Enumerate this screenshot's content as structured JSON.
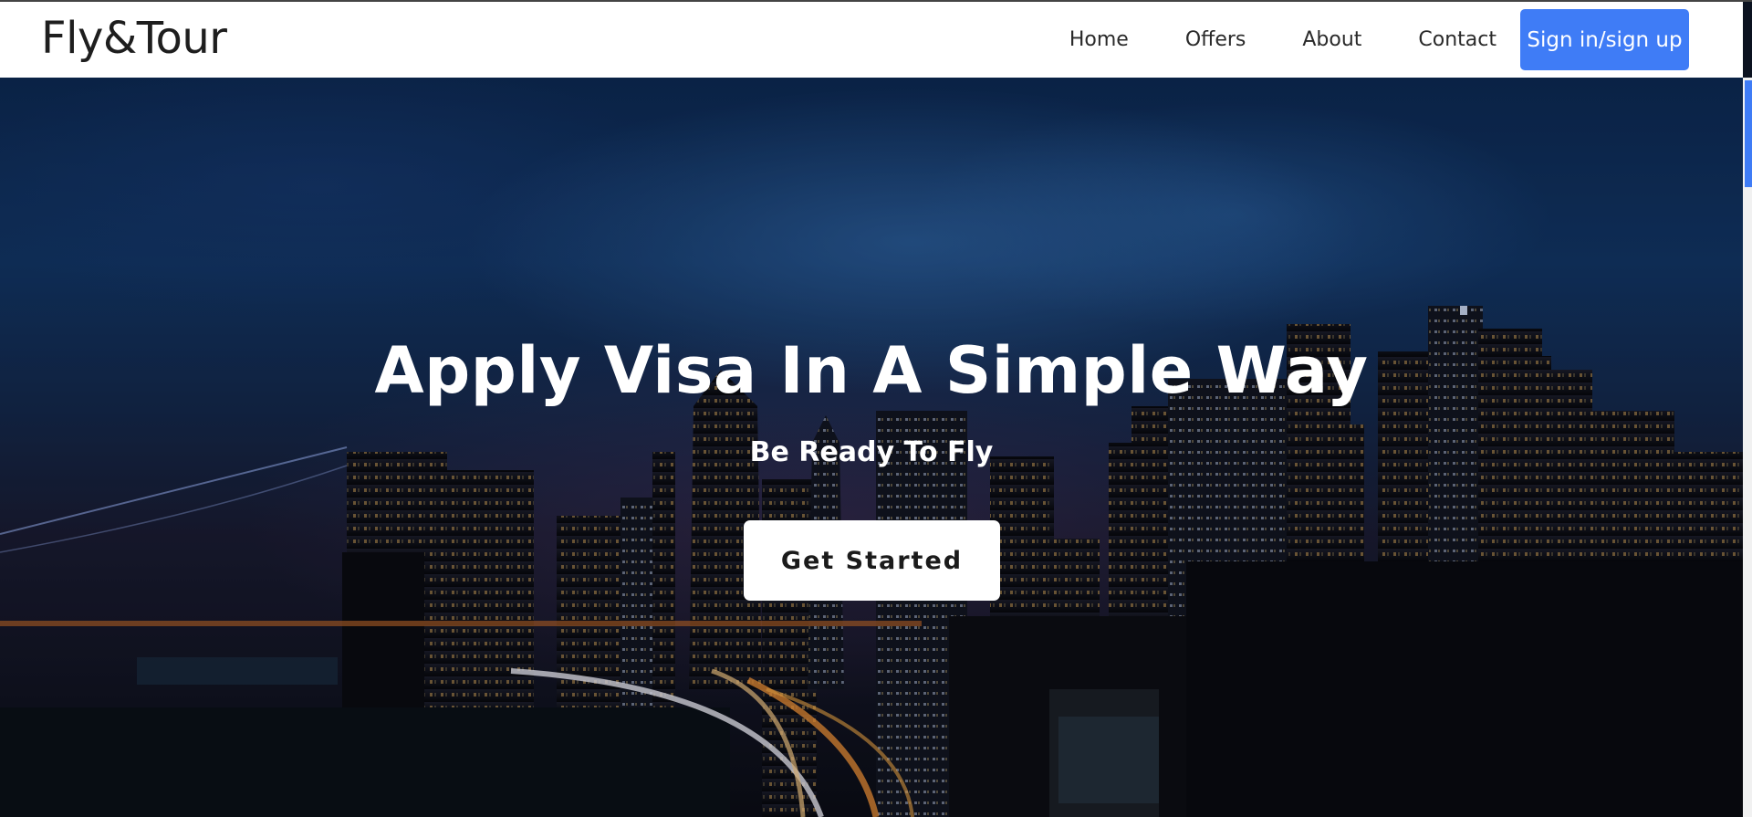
{
  "navbar": {
    "brand": "Fly&Tour",
    "links": [
      "Home",
      "Offers",
      "About",
      "Contact"
    ],
    "cta_label": "Sign in/sign up",
    "accent_color": "#3f7cf6"
  },
  "hero": {
    "title": "Apply Visa In A Simple Way",
    "subtitle": "Be Ready To Fly",
    "button_label": "Get Started"
  }
}
